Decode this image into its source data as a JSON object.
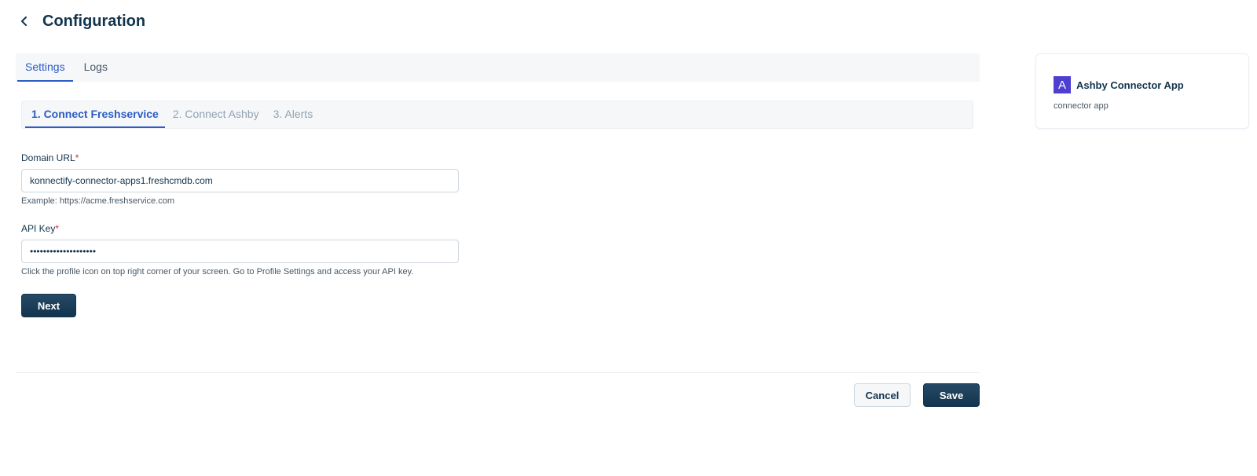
{
  "header": {
    "title": "Configuration"
  },
  "tabs": [
    {
      "label": "Settings",
      "active": true
    },
    {
      "label": "Logs",
      "active": false
    }
  ],
  "steps": [
    {
      "label": "1. Connect Freshservice",
      "active": true
    },
    {
      "label": "2. Connect Ashby",
      "active": false
    },
    {
      "label": "3. Alerts",
      "active": false
    }
  ],
  "form": {
    "domain": {
      "label": "Domain URL",
      "required_mark": "*",
      "value": "konnectify-connector-apps1.freshcmdb.com",
      "hint": "Example: https://acme.freshservice.com"
    },
    "api_key": {
      "label": "API Key",
      "required_mark": "*",
      "value": "••••••••••••••••••••",
      "hint": "Click the profile icon on top right corner of your screen. Go to Profile Settings and access your API key."
    },
    "next_label": "Next"
  },
  "footer": {
    "cancel_label": "Cancel",
    "save_label": "Save"
  },
  "app_card": {
    "logo_letter": "A",
    "name": "Ashby Connector App",
    "subtitle": "connector app"
  },
  "colors": {
    "primary": "#12344d",
    "accent_blue": "#2c5cc5",
    "app_logo": "#4e3fd1",
    "required": "#d72d30"
  },
  "icons": {
    "back": "chevron-left-icon"
  }
}
